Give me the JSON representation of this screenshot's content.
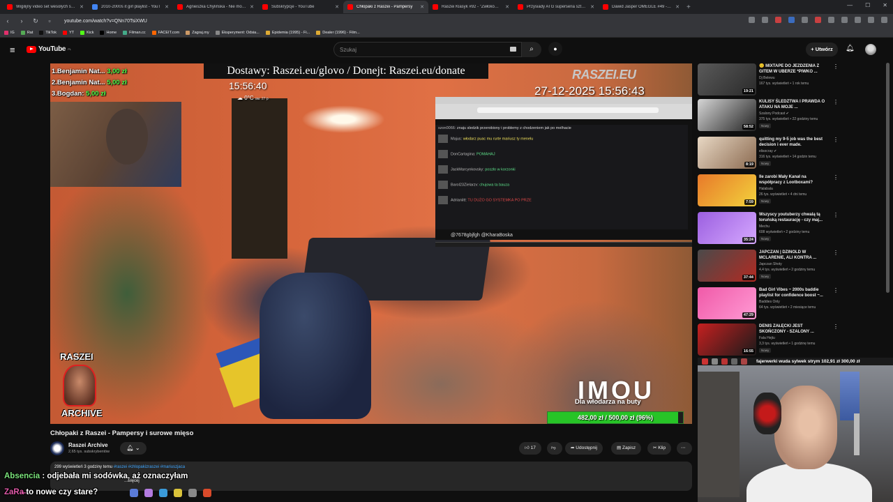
{
  "browser": {
    "tabs": [
      {
        "title": "Wigilijny video set wesołych świąt ie",
        "fav": "red"
      },
      {
        "title": "2010-2000s it girl playlist - YouT",
        "fav": "blue"
      },
      {
        "title": "Agnieszka Chylińska - Nie mogę Cię",
        "fav": "red"
      },
      {
        "title": "Subskrypcje - YouTube",
        "fav": "red"
      },
      {
        "title": "Chłopaki z Raszei - Pampersy",
        "fav": "red"
      },
      {
        "title": "Raszei Klasyk #92 - \"Żwłoków tu nie",
        "fav": "red"
      },
      {
        "title": "Przysiady ATG superseria sztanga i f",
        "fav": "red"
      },
      {
        "title": "Dawid Jasper OMEGLE #49 - JAKIE",
        "fav": "red"
      }
    ],
    "active_tab_index": 4,
    "url": "youtube.com/watch?v=QNn70TsiXWU",
    "bookmarks": [
      "IG",
      "Rat",
      "TikTok",
      "YT",
      "Kick",
      "Home",
      "Filman.cc",
      "FACEIT.com",
      "Zagraj.my",
      "Eksperyment: Odsia...",
      "Epidemia (1995) - Fi...",
      "Dealer (1996) - Film..."
    ]
  },
  "youtube": {
    "logo": "YouTube",
    "logo_country": "PL",
    "search_placeholder": "Szukaj",
    "create_label": "Utwórz"
  },
  "video_overlay": {
    "donors": [
      {
        "name": "1.Benjamin Nat...",
        "amount": "3,00 zł"
      },
      {
        "name": "2.Benjamin Nat...",
        "amount": "5,00 zł"
      },
      {
        "name": "3.Bogdan:",
        "amount": "5,00 zł"
      }
    ],
    "banner": "Dostawy: Raszei.eu/glovo / Donejt: Raszei.eu/donate",
    "clock": "15:56:40",
    "temperature": "0°C",
    "temperature_sub": "ам. 27 p",
    "channel_logo": "RASZEI.EU",
    "cam_timestamp": "27-12-2025 15:56:43",
    "chat_lines": [
      {
        "user": "szon0066:",
        "text": "znaju sledzik przerobiony i problemy z chodzeniem jak po melhacie",
        "color": "#dddddd"
      },
      {
        "user": "Majus:",
        "text": "włodarz puac mu rurte mariusz ty menelu",
        "color": "#f2e35c"
      },
      {
        "user": "DonCartagina:",
        "text": "POMAHAJ",
        "color": "#5ee08a"
      },
      {
        "user": "JackMarcynkovsky:",
        "text": "poszło w korzonki",
        "color": "#5ee08a"
      },
      {
        "user": "Barol23Zielarzv:",
        "text": "chujowa ta bauza",
        "color": "#5ee08a"
      },
      {
        "user": "Adrianiitt:",
        "text": "TU DUŻO GO SYSTEMKA PO PRZE",
        "color": "#e04848"
      }
    ],
    "chat_donor_line": "@7678gbjfgh @KharaBoska",
    "badge_top": "RASZEI",
    "badge_bottom": "ARCHIVE",
    "sponsor_logo": "IMOU",
    "sponsor_sub": "Dla włodarza na buty",
    "goal_text": "482,00 zł / 500,00 zł",
    "goal_percent": "96%",
    "goal_fraction": 0.964
  },
  "video": {
    "title": "Chłopaki z Raszei - Pampersy i surowe mięso",
    "channel": "Raszei Archive",
    "subscribers": "2,65 tys. subskrybentów",
    "likes": "17",
    "share_label": "Udostępnij",
    "save_label": "Zapisz",
    "clip_label": "Klip",
    "views_meta": "299 wyświetleń  3 godziny temu",
    "hashtags": "#raszei #chlopakizraszei #mariuszjaca",
    "desc_more": "...więcej"
  },
  "recommendations": [
    {
      "title": "🙁 MIXTAPE DO JEZDZENIA Z GITEM W UBERZE *PIWKO ...",
      "channel": "Dj Belewu",
      "meta": "167 tys. wyświetleń • 1 rok temu",
      "duration": "19:21",
      "new": "",
      "c1": "#5a5a5a",
      "c2": "#2a2a2a"
    },
    {
      "title": "KULISY ŚLEDZTWA I PRAWDA O ATAKU NA MOJE ...",
      "channel": "Szalony Podcast ✔",
      "meta": "375 tys. wyświetleń • 22 godziny temu",
      "duration": "58:52",
      "new": "Nowy",
      "c1": "#d6d6d6",
      "c2": "#222222"
    },
    {
      "title": "quitting my 9-5 job was the best decision i ever made.",
      "channel": "elisocray ✔",
      "meta": "316 tys. wyświetleń • 14 godzin temu",
      "duration": "8:19",
      "new": "Nowy",
      "c1": "#e8d8c4",
      "c2": "#8b6a50"
    },
    {
      "title": "Ile zarobi Mały Kanał na współpracy z Lootboxami?",
      "channel": "Halabala",
      "meta": "26 tys. wyświetleń • 4 dni temu",
      "duration": "7:59",
      "new": "Nowy",
      "c1": "#e8792a",
      "c2": "#f2d23c"
    },
    {
      "title": "Wszyscy youtuberzy chwalą tą toruńską restaurację - czy maj...",
      "channel": "Mechu",
      "meta": "608 wyświetleń • 2 godziny temu",
      "duration": "35:24",
      "new": "Nowy",
      "c1": "#9b5fe0",
      "c2": "#d6a8ff"
    },
    {
      "title": "JAPCZAN | DZINOLD W MCLARENIE, ALI KONTRA ...",
      "channel": "Japczan Shoty",
      "meta": "4,4 tys. wyświetleń • 2 godziny temu",
      "duration": "37:44",
      "new": "Nowy",
      "c1": "#4a4a4a",
      "c2": "#b22a22"
    },
    {
      "title": "Bad Girl Vibes ~ 2000s baddie playlist for confidence boost ~...",
      "channel": "Baddies Only",
      "meta": "64 tys. wyświetleń • 2 miesiące temu",
      "duration": "47:29",
      "new": "",
      "c1": "#f05aa8",
      "c2": "#ff9ad4"
    },
    {
      "title": "DENIS ZAŁĘCKI JEST SKOŃCZONY - SZALONY ...",
      "channel": "Fala Hejtu",
      "meta": "3,3 tys. wyświetleń • 1 godzinę temu",
      "duration": "16:55",
      "new": "Nowy",
      "c1": "#c62020",
      "c2": "#1a1a1a"
    }
  ],
  "streamer": {
    "ticker": "fajerwerki wuda sylwek strym  102,91 zł  300,00 zł"
  },
  "overlay_chat": [
    {
      "user": "Absencia",
      "text": ": odjebała mi sodówka, aż oznaczyłam"
    },
    {
      "user": "ZaRa̶",
      "text": "to nowe czy stare?"
    }
  ]
}
